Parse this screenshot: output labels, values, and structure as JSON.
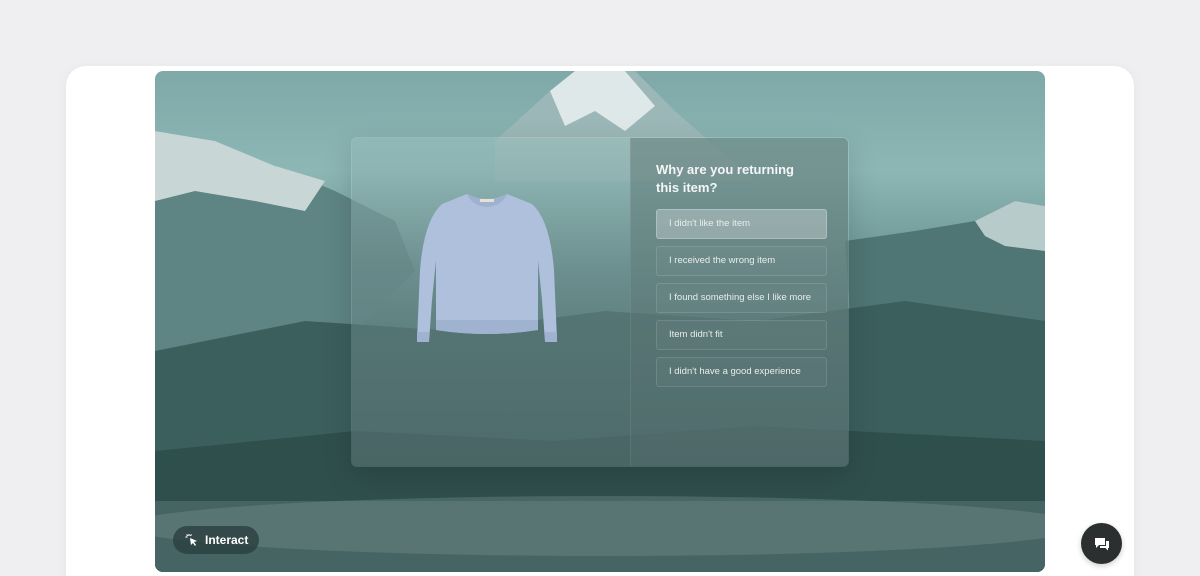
{
  "modal": {
    "question": "Why are you returning this item?",
    "options": [
      {
        "label": "I didn't like the item",
        "selected": true
      },
      {
        "label": "I received the wrong item",
        "selected": false
      },
      {
        "label": "I found something else I like more",
        "selected": false
      },
      {
        "label": "Item didn't fit",
        "selected": false
      },
      {
        "label": "I didn't have a good experience",
        "selected": false
      }
    ]
  },
  "interact_button": {
    "label": "Interact",
    "icon": "pointer-click-icon"
  },
  "chat_button": {
    "icon": "chat-bubbles-icon"
  },
  "colors": {
    "page_bg": "#efeff1",
    "card_bg": "#ffffff",
    "chat_fab": "#2b2f2f",
    "sweater": "#aec0dc"
  }
}
